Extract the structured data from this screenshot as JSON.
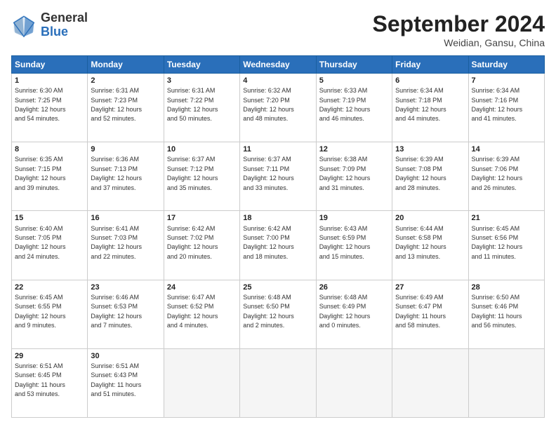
{
  "header": {
    "logo_general": "General",
    "logo_blue": "Blue",
    "month_title": "September 2024",
    "location": "Weidian, Gansu, China"
  },
  "weekdays": [
    "Sunday",
    "Monday",
    "Tuesday",
    "Wednesday",
    "Thursday",
    "Friday",
    "Saturday"
  ],
  "weeks": [
    [
      {
        "day": "1",
        "info": "Sunrise: 6:30 AM\nSunset: 7:25 PM\nDaylight: 12 hours\nand 54 minutes."
      },
      {
        "day": "2",
        "info": "Sunrise: 6:31 AM\nSunset: 7:23 PM\nDaylight: 12 hours\nand 52 minutes."
      },
      {
        "day": "3",
        "info": "Sunrise: 6:31 AM\nSunset: 7:22 PM\nDaylight: 12 hours\nand 50 minutes."
      },
      {
        "day": "4",
        "info": "Sunrise: 6:32 AM\nSunset: 7:20 PM\nDaylight: 12 hours\nand 48 minutes."
      },
      {
        "day": "5",
        "info": "Sunrise: 6:33 AM\nSunset: 7:19 PM\nDaylight: 12 hours\nand 46 minutes."
      },
      {
        "day": "6",
        "info": "Sunrise: 6:34 AM\nSunset: 7:18 PM\nDaylight: 12 hours\nand 44 minutes."
      },
      {
        "day": "7",
        "info": "Sunrise: 6:34 AM\nSunset: 7:16 PM\nDaylight: 12 hours\nand 41 minutes."
      }
    ],
    [
      {
        "day": "8",
        "info": "Sunrise: 6:35 AM\nSunset: 7:15 PM\nDaylight: 12 hours\nand 39 minutes."
      },
      {
        "day": "9",
        "info": "Sunrise: 6:36 AM\nSunset: 7:13 PM\nDaylight: 12 hours\nand 37 minutes."
      },
      {
        "day": "10",
        "info": "Sunrise: 6:37 AM\nSunset: 7:12 PM\nDaylight: 12 hours\nand 35 minutes."
      },
      {
        "day": "11",
        "info": "Sunrise: 6:37 AM\nSunset: 7:11 PM\nDaylight: 12 hours\nand 33 minutes."
      },
      {
        "day": "12",
        "info": "Sunrise: 6:38 AM\nSunset: 7:09 PM\nDaylight: 12 hours\nand 31 minutes."
      },
      {
        "day": "13",
        "info": "Sunrise: 6:39 AM\nSunset: 7:08 PM\nDaylight: 12 hours\nand 28 minutes."
      },
      {
        "day": "14",
        "info": "Sunrise: 6:39 AM\nSunset: 7:06 PM\nDaylight: 12 hours\nand 26 minutes."
      }
    ],
    [
      {
        "day": "15",
        "info": "Sunrise: 6:40 AM\nSunset: 7:05 PM\nDaylight: 12 hours\nand 24 minutes."
      },
      {
        "day": "16",
        "info": "Sunrise: 6:41 AM\nSunset: 7:03 PM\nDaylight: 12 hours\nand 22 minutes."
      },
      {
        "day": "17",
        "info": "Sunrise: 6:42 AM\nSunset: 7:02 PM\nDaylight: 12 hours\nand 20 minutes."
      },
      {
        "day": "18",
        "info": "Sunrise: 6:42 AM\nSunset: 7:00 PM\nDaylight: 12 hours\nand 18 minutes."
      },
      {
        "day": "19",
        "info": "Sunrise: 6:43 AM\nSunset: 6:59 PM\nDaylight: 12 hours\nand 15 minutes."
      },
      {
        "day": "20",
        "info": "Sunrise: 6:44 AM\nSunset: 6:58 PM\nDaylight: 12 hours\nand 13 minutes."
      },
      {
        "day": "21",
        "info": "Sunrise: 6:45 AM\nSunset: 6:56 PM\nDaylight: 12 hours\nand 11 minutes."
      }
    ],
    [
      {
        "day": "22",
        "info": "Sunrise: 6:45 AM\nSunset: 6:55 PM\nDaylight: 12 hours\nand 9 minutes."
      },
      {
        "day": "23",
        "info": "Sunrise: 6:46 AM\nSunset: 6:53 PM\nDaylight: 12 hours\nand 7 minutes."
      },
      {
        "day": "24",
        "info": "Sunrise: 6:47 AM\nSunset: 6:52 PM\nDaylight: 12 hours\nand 4 minutes."
      },
      {
        "day": "25",
        "info": "Sunrise: 6:48 AM\nSunset: 6:50 PM\nDaylight: 12 hours\nand 2 minutes."
      },
      {
        "day": "26",
        "info": "Sunrise: 6:48 AM\nSunset: 6:49 PM\nDaylight: 12 hours\nand 0 minutes."
      },
      {
        "day": "27",
        "info": "Sunrise: 6:49 AM\nSunset: 6:47 PM\nDaylight: 11 hours\nand 58 minutes."
      },
      {
        "day": "28",
        "info": "Sunrise: 6:50 AM\nSunset: 6:46 PM\nDaylight: 11 hours\nand 56 minutes."
      }
    ],
    [
      {
        "day": "29",
        "info": "Sunrise: 6:51 AM\nSunset: 6:45 PM\nDaylight: 11 hours\nand 53 minutes."
      },
      {
        "day": "30",
        "info": "Sunrise: 6:51 AM\nSunset: 6:43 PM\nDaylight: 11 hours\nand 51 minutes."
      },
      {
        "day": "",
        "info": ""
      },
      {
        "day": "",
        "info": ""
      },
      {
        "day": "",
        "info": ""
      },
      {
        "day": "",
        "info": ""
      },
      {
        "day": "",
        "info": ""
      }
    ]
  ]
}
